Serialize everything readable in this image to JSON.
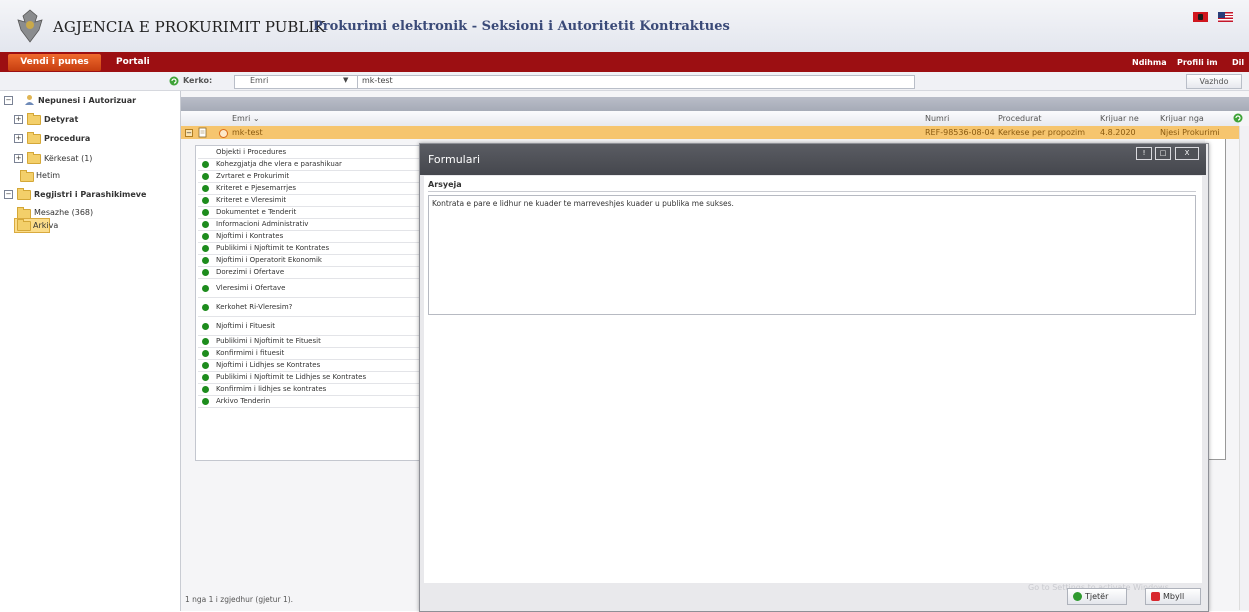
{
  "header": {
    "agency": "AGJENCIA E PROKURIMIT PUBLIK",
    "subtitle": "Prokurimi elektronik - Seksioni i Autoritetit Kontraktues"
  },
  "nav": {
    "work": "Vendi i punes",
    "portal": "Portali",
    "help": "Ndihma",
    "profile": "Profili im",
    "exit": "Dil"
  },
  "search": {
    "label": "Kerko:",
    "field": "Emri",
    "value": "mk-test",
    "button": "Vazhdo"
  },
  "sidebar": {
    "items": [
      {
        "label": "Nepunesi i Autorizuar"
      },
      {
        "label": "Detyrat"
      },
      {
        "label": "Procedura"
      },
      {
        "label": "Kërkesat (1)"
      },
      {
        "label": "Hetim"
      },
      {
        "label": "Regjistri i Parashikimeve"
      },
      {
        "label": "Mesazhe (368)"
      },
      {
        "label": "Arkiva"
      }
    ]
  },
  "grid": {
    "columns": [
      "Emri",
      "Numri",
      "Procedurat",
      "Krijuar ne",
      "Krijuar nga"
    ],
    "sort_indicator": "⌄",
    "row": {
      "name": "mk-test",
      "number": "REF-98536-08-04",
      "procedure": "Kerkese per propozim",
      "created_on": "4.8.2020",
      "created_by": "Njesi Prokurimi"
    },
    "footer": "1 nga 1 i zgjedhur (gjetur 1)."
  },
  "steps": [
    "Objekti i Procedures",
    "Kohezgjatja dhe vlera e parashikuar",
    "Zvrtaret e Prokurimit",
    "Kriteret e Pjesemarrjes",
    "Kriteret e Vleresimit",
    "Dokumentet e Tenderit",
    "Informacioni Administrativ",
    "Njoftimi i Kontrates",
    "Publikimi i Njoftimit te Kontrates",
    "Njoftimi i Operatorit Ekonomik",
    "Dorezimi i Ofertave",
    "Vleresimi i Ofertave",
    "Kerkohet Ri-Vleresim?",
    "Njoftimi i Fituesit",
    "Publikimi i Njoftimit te Fituesit",
    "Konfirmimi i fituesit",
    "Njoftimi i Lidhjes se Kontrates",
    "Publikimi i Njoftimit te Lidhjes se Kontrates",
    "Konfirmim i lidhjes se kontrates",
    "Arkivo Tenderin"
  ],
  "modal": {
    "title": "Formulari",
    "field_label": "Arsyeja",
    "field_value": "Kontrata e pare e lidhur ne kuader te marreveshjes kuader u publika me sukses.",
    "btn_min": "!",
    "btn_max": "□",
    "btn_close": "X",
    "next_button": "Tjetër",
    "close_button": "Mbyll",
    "watermark": "Go to Settings to activate Windows."
  },
  "colors": {
    "nav": "#9c0f12",
    "active_tab": "#e0561f",
    "selected_row": "#f6c56e",
    "modal_header": "#4e5056"
  }
}
